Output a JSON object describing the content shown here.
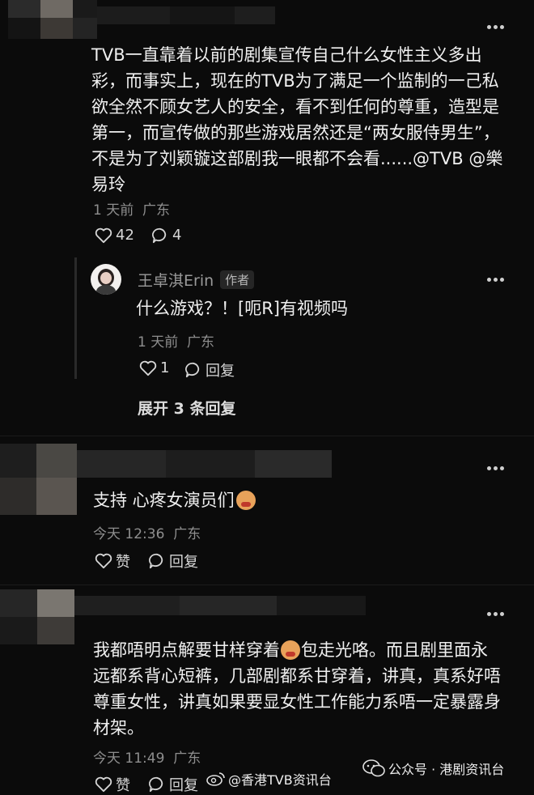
{
  "comments": [
    {
      "text": "TVB一直靠着以前的剧集宣传自己什么女性主义多出彩，而事实上，现在的TVB为了满足一个监制的一己私欲全然不顾女艺人的安全，看不到任何的尊重，造型是第一，而宣传做的那些游戏居然还是“两女服侍男生”，不是为了刘颖镟这部剧我一眼都不会看......@TVB @樂易玲",
      "lines": [
        "TVB一直靠着以前的剧集宣传自己什么女性主义多出",
        "彩，而事实上，现在的TVB为了满足一个监制的一己私",
        "欲全然不顾女艺人的安全，看不到任何的尊重，造型是",
        "第一，而宣传做的那些游戏居然还是“两女服侍男生”，",
        "不是为了刘颖镟这部剧我一眼都不会看......@TVB @樂",
        "易玲"
      ],
      "time": "1 天前",
      "location": "广东",
      "likes": "42",
      "replies": "4"
    },
    {
      "text": "支持 心疼女演员们",
      "lines": [
        "支持 心疼女演员们"
      ],
      "time": "今天 12:36",
      "location": "广东",
      "like_label": "赞",
      "reply_label": "回复"
    },
    {
      "text": "我都唔明点解要甘样穿着包走光咯。而且剧里面永远都系背心短裤，几部剧都系甘穿着，讲真，真系好唔尊重女性，讲真如果要显女性工作能力系唔一定暴露身材架。",
      "lines": [
        "我都唔明点解要甘样穿着",
        "包走光咯。而且剧里面永",
        "远都系背心短裤，几部剧都系甘穿着，讲真，真系好唔",
        "尊重女性，讲真如果要显女性工作能力系唔一定暴露身",
        "材架。"
      ],
      "time": "今天 11:49",
      "location": "广东",
      "like_label": "赞",
      "reply_label": "回复"
    }
  ],
  "reply": {
    "author": "王卓淇Erin",
    "badge": "作者",
    "text": "什么游戏？！[呃R]有视频吗",
    "time": "1 天前",
    "location": "广东",
    "likes": "1",
    "reply_label": "回复"
  },
  "expand_label": "展开 3 条回复",
  "watermarks": {
    "weibo": "@香港TVB资讯台",
    "wechat": "公众号 · 港剧资讯台"
  },
  "icons": [
    "more-icon",
    "heart-icon",
    "comment-icon",
    "emoji-icon",
    "weibo-icon",
    "wechat-icon"
  ],
  "colors": {
    "background": "#0b0b0b",
    "text": "#f0f0f0",
    "meta": "#8e8e8e"
  }
}
